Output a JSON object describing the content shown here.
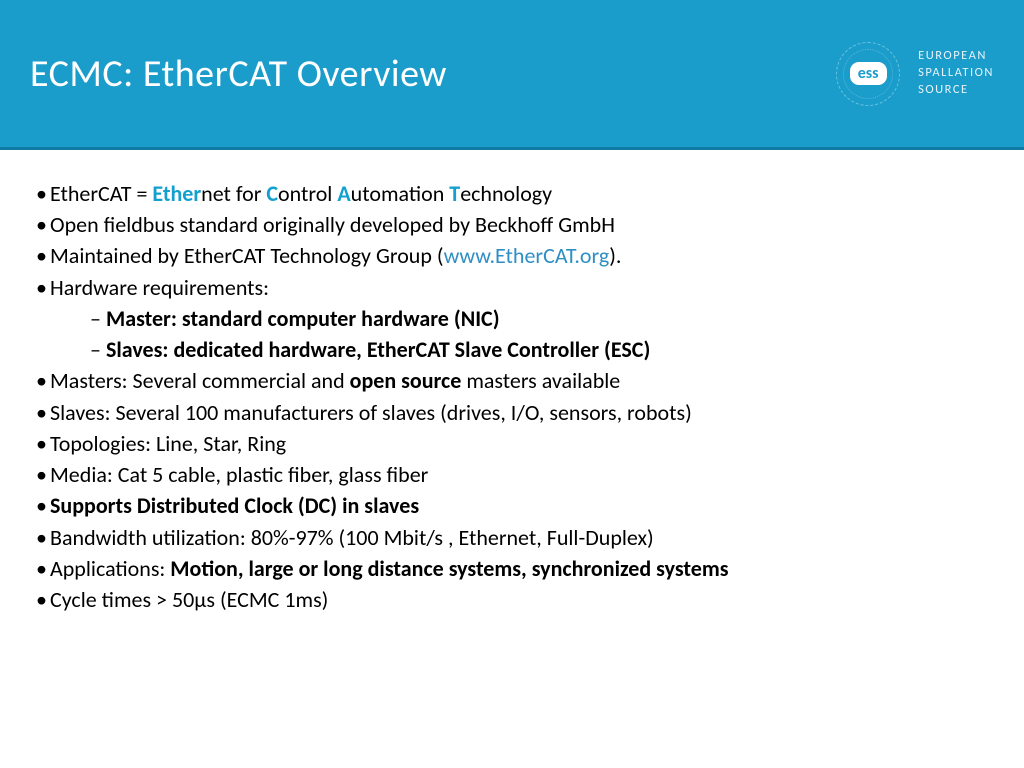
{
  "header": {
    "title": "ECMC: EtherCAT Overview",
    "logo_text": "ess",
    "brand_line1": "EUROPEAN",
    "brand_line2": "SPALLATION",
    "brand_line3": "SOURCE"
  },
  "bullets": {
    "b1_pre": "EtherCAT = ",
    "b1_ether": "Ether",
    "b1_net": "net for ",
    "b1_c": "C",
    "b1_ontrol": "ontrol ",
    "b1_a": "A",
    "b1_utomation": "utomation ",
    "b1_t": "T",
    "b1_echnology": "echnology",
    "b2": "Open fieldbus standard originally developed by Beckhoff GmbH",
    "b3_pre": "Maintained by EtherCAT Technology Group (",
    "b3_link": "www.EtherCAT.org",
    "b3_post": ").",
    "b4": "Hardware requirements:",
    "b4s1": "Master: standard computer hardware (NIC)",
    "b4s2": "Slaves: dedicated hardware, EtherCAT Slave Controller (ESC)",
    "b5_pre": "Masters: Several commercial and ",
    "b5_bold": "open source",
    "b5_post": " masters available",
    "b6": "Slaves: Several 100 manufacturers of slaves (drives, I/O, sensors, robots)",
    "b7": "Topologies: Line, Star, Ring",
    "b8": "Media: Cat 5 cable, plastic fiber, glass fiber",
    "b9": "Supports Distributed Clock (DC) in slaves",
    "b10": "Bandwidth utilization: 80%-97% (100 Mbit/s , Ethernet, Full-Duplex)",
    "b11_pre": "Applications: ",
    "b11_bold": "Motion, large or long distance systems, synchronized systems",
    "b12": "Cycle times > 50µs (ECMC 1ms)"
  }
}
